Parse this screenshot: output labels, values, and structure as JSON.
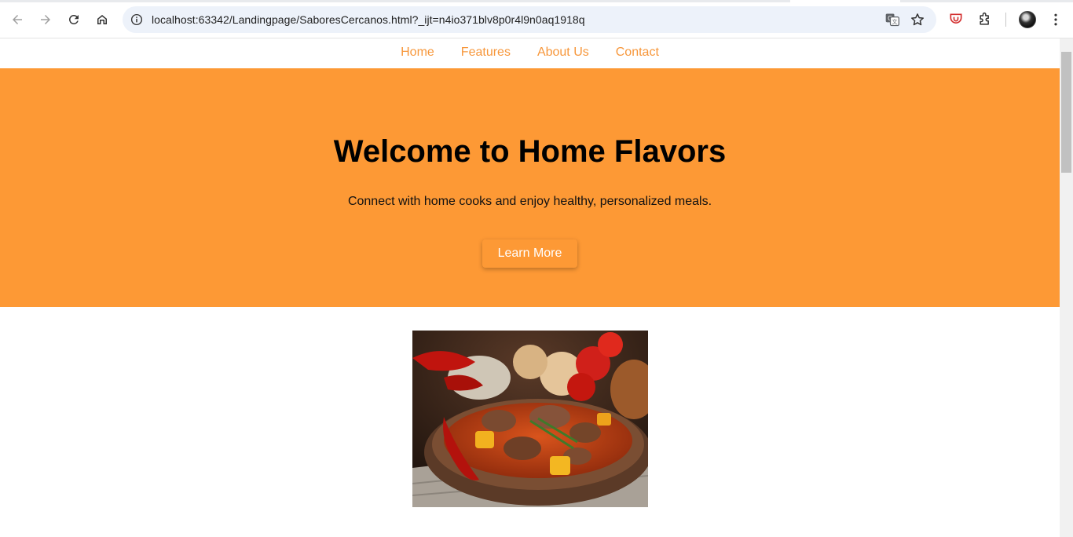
{
  "browser": {
    "url": "localhost:63342/Landingpage/SaboresCercanos.html?_ijt=n4io371blv8p0r4l9n0aq1918q",
    "icons": [
      "back-arrow-icon",
      "forward-arrow-icon",
      "reload-icon",
      "home-icon",
      "site-info-icon",
      "translate-icon",
      "star-icon",
      "extension-shield-icon",
      "puzzle-icon",
      "avatar",
      "kebab-menu-icon"
    ]
  },
  "nav": {
    "items": [
      {
        "label": "Home"
      },
      {
        "label": "Features"
      },
      {
        "label": "About Us"
      },
      {
        "label": "Contact"
      }
    ]
  },
  "hero": {
    "title": "Welcome to Home Flavors",
    "subtitle": "Connect with home cooks and enjoy healthy, personalized meals.",
    "cta_label": "Learn More"
  },
  "image": {
    "subject": "bowl-of-meat-stew-with-vegetables"
  },
  "colors": {
    "accent": "#fd9935",
    "nav_link": "#f7973b"
  }
}
